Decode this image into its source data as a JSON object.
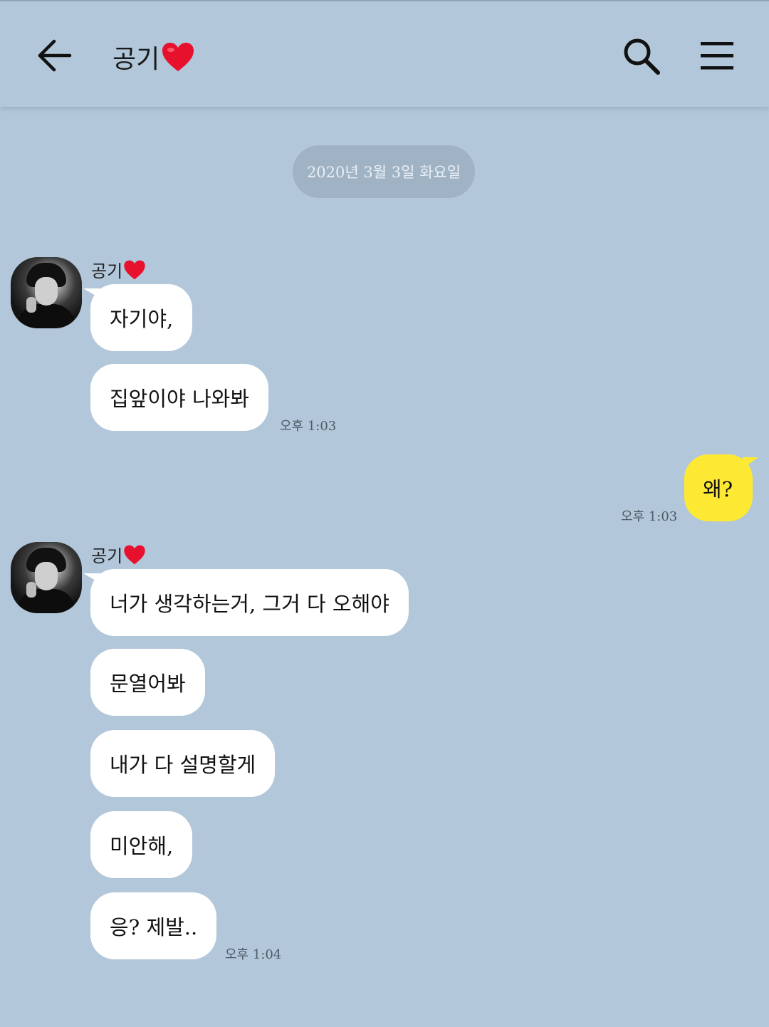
{
  "header": {
    "title": "공기",
    "title_emoji": "heart",
    "back_icon": "arrow-left-icon",
    "search_icon": "search-icon",
    "menu_icon": "hamburger-menu-icon"
  },
  "date_divider": "2020년 3월 3일 화요일",
  "groups": [
    {
      "sender": "공기",
      "messages": [
        "자기야,",
        "집앞이야 나와봐"
      ],
      "time": "오후 1:03"
    },
    {
      "mine": true,
      "messages": [
        "왜?"
      ],
      "time": "오후 1:03"
    },
    {
      "sender": "공기",
      "messages": [
        "너가 생각하는거, 그거 다 오해야",
        "문열어봐",
        "내가 다 설명할게",
        "미안해,",
        "응? 제발.."
      ],
      "time": "오후 1:04"
    }
  ],
  "colors": {
    "background": "#b2c7da",
    "my_bubble": "#fde934",
    "their_bubble": "#ffffff",
    "heart": "#e8112d"
  }
}
